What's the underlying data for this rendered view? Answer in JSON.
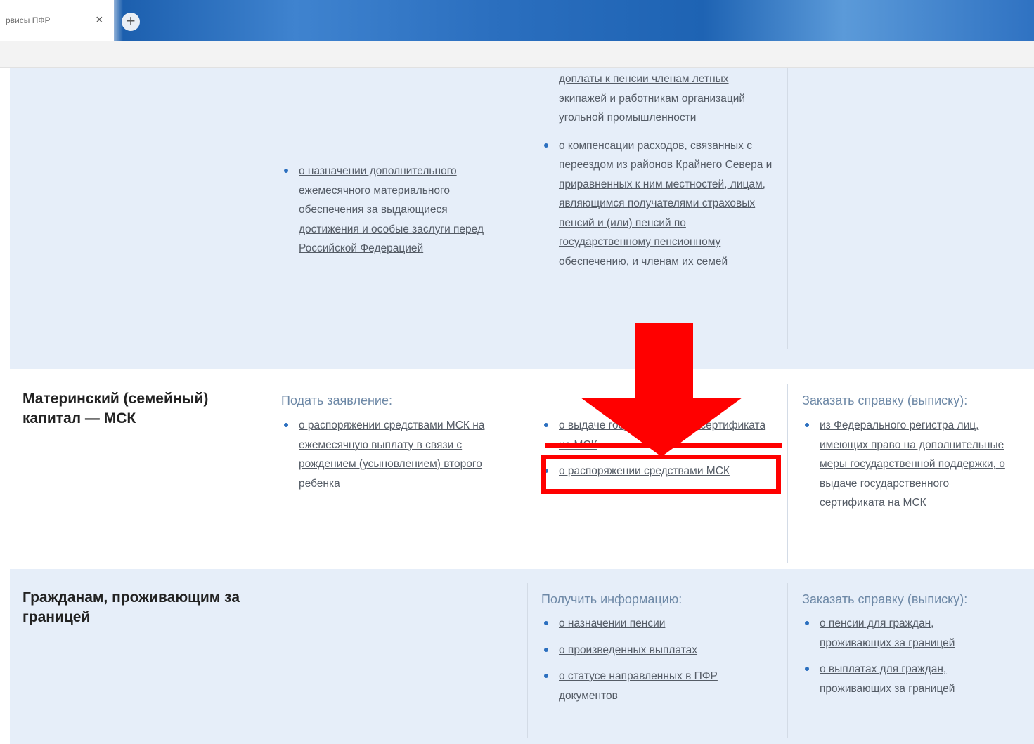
{
  "browser": {
    "tab_title": "рвисы ПФР",
    "close_glyph": "×",
    "new_tab_glyph": "+"
  },
  "section_top": {
    "col1_links": [
      "о назначении дополнительного ежемесячного материального обеспечения за выдающиеся достижения и особые заслуги перед Российской Федерацией"
    ],
    "col2_links": [
      "доплаты к пенсии членам летных экипажей и работникам организаций угольной промышленности",
      "о компенсации расходов, связанных с переездом из районов Крайнего Севера и приравненных к ним местностей, лицам, являющимся получателями страховых пенсий и (или) пенсий по государственному пенсионному обеспечению, и членам их семей"
    ]
  },
  "section_msk": {
    "title": "Материнский (семейный) капитал — МСК",
    "col1_head": "Подать заявление:",
    "col1_links": [
      "о распоряжении средствами МСК на ежемесячную выплату в связи с рождением (усыновлением) второго ребенка"
    ],
    "col2_links": [
      "о выдаче государственного сертификата на МСК",
      "о распоряжении средствами МСК"
    ],
    "col3_head": "Заказать справку (выписку):",
    "col3_links": [
      "из Федерального регистра лиц, имеющих право на дополнительные меры государственной поддержки, о выдаче государственного сертификата на МСК"
    ]
  },
  "section_abroad": {
    "title": "Гражданам, проживающим за границей",
    "col2_head": "Получить информацию:",
    "col2_links": [
      "о назначении пенсии",
      "о произведенных выплатах",
      "о статусе направленных в ПФР документов"
    ],
    "col3_head": "Заказать справку (выписку):",
    "col3_links": [
      "о пенсии для граждан, проживающих за границей",
      "о выплатах для граждан, проживающих за границей"
    ]
  },
  "annotation": {
    "color": "#ff0000"
  }
}
